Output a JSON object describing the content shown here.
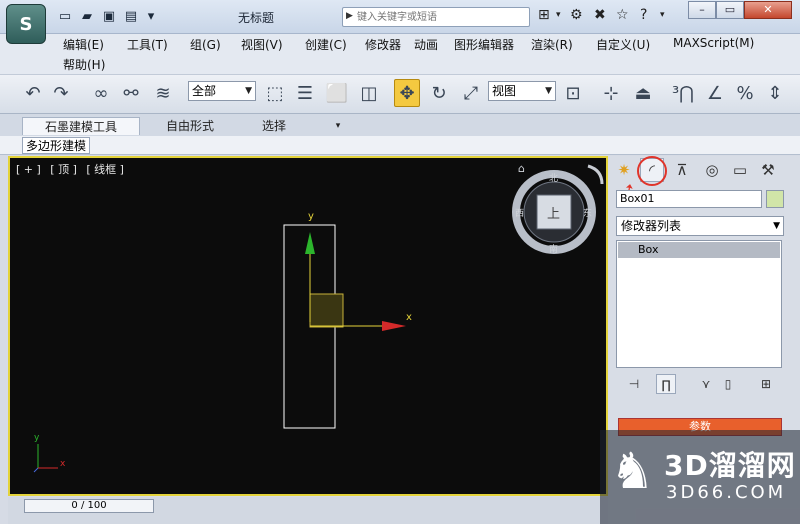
{
  "titlebar": {
    "title": "无标题",
    "search_placeholder": "键入关键字或短语",
    "search_arrow": "▶"
  },
  "menu": {
    "items": [
      "编辑(E)",
      "工具(T)",
      "组(G)",
      "视图(V)",
      "创建(C)",
      "修改器",
      "动画",
      "图形编辑器",
      "渲染(R)",
      "自定义(U)",
      "MAXScript(M)",
      "帮助(H)"
    ]
  },
  "toolbar": {
    "selection_filter": "全部",
    "ref_coord": "视图"
  },
  "ribbon": {
    "tabs": [
      "石墨建模工具",
      "自由形式",
      "选择"
    ],
    "subtab": "多边形建模"
  },
  "viewport": {
    "labels": [
      "[ + ]",
      "[ 顶 ]",
      "[ 线框 ]"
    ],
    "axis_y": "y",
    "axis_x": "x",
    "viewcube_top": "上",
    "compass_n": "北",
    "compass_s": "南",
    "compass_w": "西",
    "compass_e": "东"
  },
  "command_panel": {
    "object_name": "Box01",
    "modifier_list": "修改器列表",
    "stack_items": [
      "Box"
    ],
    "rollout": "参数",
    "object_color": "#d1e5a8"
  },
  "timeline": {
    "frame": "0 / 100"
  },
  "watermark": {
    "cn": "3D溜溜网",
    "en": "3D66.COM"
  },
  "colors": {
    "viewport_border": "#e3d33a",
    "viewport_bg": "#0c0c0c",
    "highlight_red": "#e0342a",
    "active_tool": "#f4c940"
  }
}
